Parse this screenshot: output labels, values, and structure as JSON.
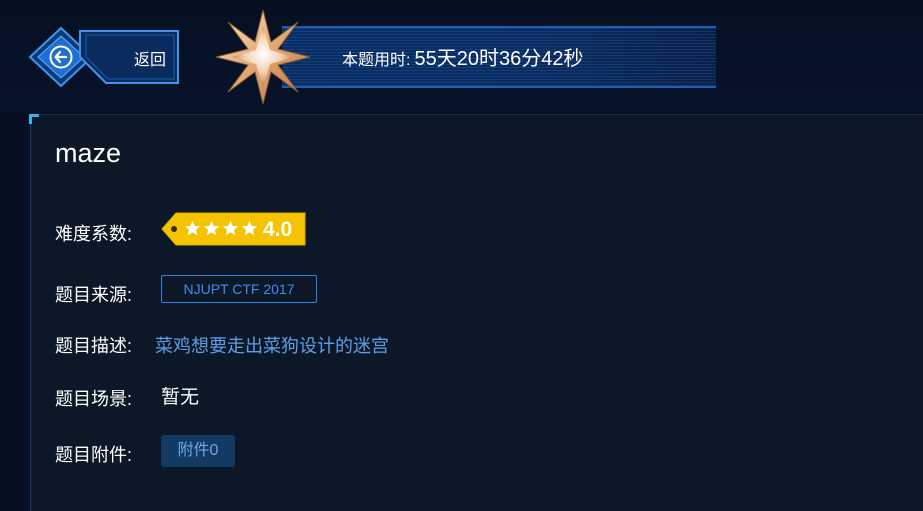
{
  "header": {
    "back_label": "返回",
    "timer_label": "本题用时:",
    "timer_value": "55天20时36分42秒"
  },
  "challenge": {
    "title": "maze",
    "difficulty_label": "难度系数:",
    "difficulty_stars": 4,
    "difficulty_value": "4.0",
    "source_label": "题目来源:",
    "source_value": "NJUPT CTF 2017",
    "description_label": "题目描述:",
    "description_value": "菜鸡想要走出菜狗设计的迷宫",
    "scene_label": "题目场景:",
    "scene_value": "暂无",
    "attachment_label": "题目附件:",
    "attachment_button": "附件0"
  },
  "icons": {
    "back": "arrow-left-icon",
    "medal": "star-medal-icon",
    "rating": "star-icon"
  },
  "colors": {
    "background": "#071022",
    "panel": "#0c1827",
    "accent_blue": "#2f7fe0",
    "rating_gold": "#f5c400",
    "description_text": "#5f9ee6"
  }
}
